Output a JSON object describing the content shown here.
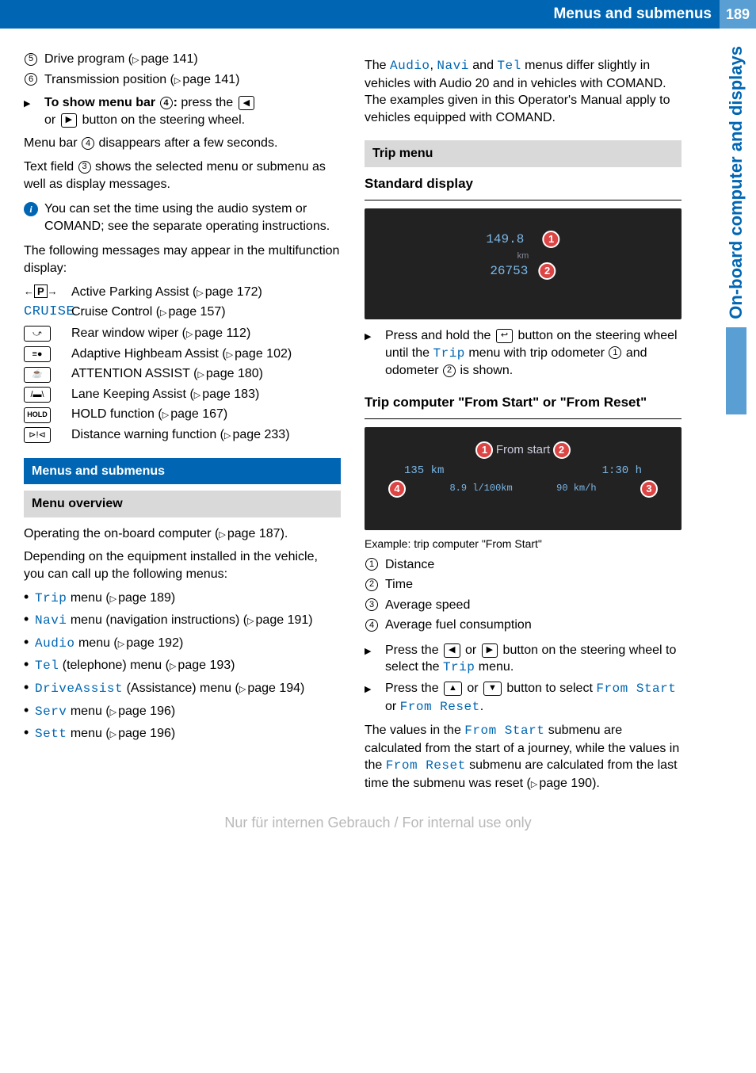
{
  "header": {
    "title": "Menus and submenus",
    "page_number": "189"
  },
  "sidebar": {
    "label": "On-board computer and displays"
  },
  "col1": {
    "num_items": [
      {
        "n": "5",
        "text": "Drive program (",
        "ref": "page 141)"
      },
      {
        "n": "6",
        "text": "Transmission position (",
        "ref": "page 141)"
      }
    ],
    "show_menu_prefix": "To show menu bar ",
    "show_menu_suffix": ":",
    "show_menu_tail": " press the ",
    "show_menu_line2a": "or ",
    "show_menu_line2b": " button on the steering wheel.",
    "menubar_disappears_a": "Menu bar ",
    "menubar_disappears_b": " disappears after a few seconds.",
    "textfield_a": "Text field ",
    "textfield_b": " shows the selected menu or submenu as well as display messages.",
    "info_text": "You can set the time using the audio system or COMAND; see the separate operating instructions.",
    "following_msgs": "The following messages may appear in the multifunction display:",
    "icon_list": [
      {
        "icon": "P",
        "icon_style": "park",
        "text": "Active Parking Assist (",
        "ref": "page 172)"
      },
      {
        "icon": "CRUISE",
        "icon_style": "cruise",
        "text": "Cruise Control (",
        "ref": "page 157)"
      },
      {
        "icon": "wiper",
        "icon_style": "box",
        "text": "Rear window wiper (",
        "ref": "page 112)"
      },
      {
        "icon": "beam",
        "icon_style": "box",
        "text": "Adaptive Highbeam Assist (",
        "ref": "page 102)"
      },
      {
        "icon": "cup",
        "icon_style": "box",
        "text": "ATTENTION ASSIST (",
        "ref": "page 180)"
      },
      {
        "icon": "lane",
        "icon_style": "box",
        "text": "Lane Keeping Assist (",
        "ref": "page 183)"
      },
      {
        "icon": "HOLD",
        "icon_style": "hold",
        "text": "HOLD function (",
        "ref": "page 167)"
      },
      {
        "icon": "dist",
        "icon_style": "box",
        "text": "Distance warning function (",
        "ref": "page 233)"
      }
    ],
    "menus_heading": "Menus and submenus",
    "menu_overview": "Menu overview",
    "operating_a": "Operating the on-board computer (",
    "operating_ref": "page 187).",
    "depending": "Depending on the equipment installed in the vehicle, you can call up the following menus:",
    "menus": [
      {
        "name": "Trip",
        "tail": " menu (",
        "ref": "page 189)"
      },
      {
        "name": "Navi",
        "tail": " menu (navigation instructions) (",
        "ref": "page 191)"
      },
      {
        "name": "Audio",
        "tail": " menu (",
        "ref": "page 192)"
      },
      {
        "name": "Tel",
        "tail": " (telephone) menu (",
        "ref": "page 193)"
      },
      {
        "name": "DriveAssist",
        "tail": " (Assistance) menu (",
        "ref": "page 194)"
      },
      {
        "name": "Serv",
        "tail": " menu (",
        "ref": "page 196)"
      },
      {
        "name": "Sett",
        "tail": " menu (",
        "ref": "page 196)"
      }
    ]
  },
  "col2": {
    "intro_a": "The ",
    "intro_b": ", ",
    "intro_c": " and ",
    "intro_d": " menus differ slightly in vehicles with Audio 20 and in vehicles with COMAND. The examples given in this Operator's Manual apply to vehicles equipped with COMAND.",
    "intro_m1": "Audio",
    "intro_m2": "Navi",
    "intro_m3": "Tel",
    "trip_menu": "Trip menu",
    "standard_display": "Standard display",
    "img1": {
      "val1": "149.8",
      "unit": "km",
      "val2": "26753"
    },
    "press_hold_a": "Press and hold the ",
    "press_hold_b": " button on the steering wheel until the ",
    "press_hold_c": " menu with trip odometer ",
    "press_hold_d": " and odometer ",
    "press_hold_e": " is shown.",
    "trip_name": "Trip",
    "trip_comp_heading": "Trip computer \"From Start\" or \"From Reset\"",
    "img2": {
      "title": "From start",
      "v1": "135 km",
      "v2": "1:30 h",
      "v3": "8.9 l/100km",
      "v4": "90 km/h"
    },
    "caption": "Example: trip computer \"From Start\"",
    "legend": [
      {
        "n": "1",
        "t": "Distance"
      },
      {
        "n": "2",
        "t": "Time"
      },
      {
        "n": "3",
        "t": "Average speed"
      },
      {
        "n": "4",
        "t": "Average fuel consumption"
      }
    ],
    "press_lr_a": "Press the ",
    "press_lr_b": " or ",
    "press_lr_c": " button on the steering wheel to select the ",
    "press_lr_d": " menu.",
    "press_ud_a": "Press the ",
    "press_ud_b": " or ",
    "press_ud_c": " button to select ",
    "press_ud_d": " or ",
    "press_ud_e": ".",
    "from_start": "From Start",
    "from_reset": "From Reset",
    "values_a": "The values in the ",
    "values_b": " submenu are calculated from the start of a journey, while the values in the ",
    "values_c": " submenu are calculated from the last time the submenu was reset (",
    "values_ref": "page 190)."
  },
  "watermark": "Nur für internen Gebrauch / For internal use only"
}
